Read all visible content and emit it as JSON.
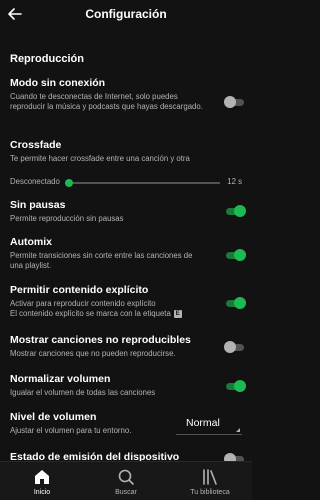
{
  "header": {
    "title": "Configuración"
  },
  "section": {
    "title": "Reproducción"
  },
  "settings": {
    "offline": {
      "title": "Modo sin conexión",
      "desc": "Cuando te desconectas de Internet, solo puedes reproducir la música y podcasts que hayas descargado.",
      "enabled": false
    },
    "crossfade": {
      "title": "Crossfade",
      "desc": "Te permite hacer crossfade entre una canción y otra",
      "min_label": "Desconectado",
      "max_label": "12 s",
      "value_fraction": 0.02
    },
    "gapless": {
      "title": "Sin pausas",
      "desc": "Permite reproducción sin pausas",
      "enabled": true
    },
    "automix": {
      "title": "Automix",
      "desc": "Permite transiciones sin corte entre las canciones de una playlist.",
      "enabled": true
    },
    "explicit": {
      "title": "Permitir contenido explícito",
      "desc1": "Activar para reproducir contenido explícito",
      "desc2": "El contenido explícito se marca con la etiqueta",
      "badge": "E",
      "enabled": true
    },
    "unplayable": {
      "title": "Mostrar canciones no reproducibles",
      "desc": "Mostrar canciones que no pueden reproducirse.",
      "enabled": false
    },
    "normalize": {
      "title": "Normalizar volumen",
      "desc": "Igualar el volumen de todas las canciones",
      "enabled": true
    },
    "volume_level": {
      "title": "Nivel de volumen",
      "desc": "Ajustar el volumen para tu entorno.",
      "value": "Normal"
    },
    "broadcast": {
      "title": "Estado de emisión del dispositivo",
      "enabled": false
    }
  },
  "navbar": {
    "items": [
      {
        "label": "Inicio",
        "icon": "home-icon",
        "active": true
      },
      {
        "label": "Buscar",
        "icon": "search-icon",
        "active": false
      },
      {
        "label": "Tu biblioteca",
        "icon": "library-icon",
        "active": false
      }
    ]
  },
  "colors": {
    "accent": "#1db954",
    "background": "#121212"
  }
}
